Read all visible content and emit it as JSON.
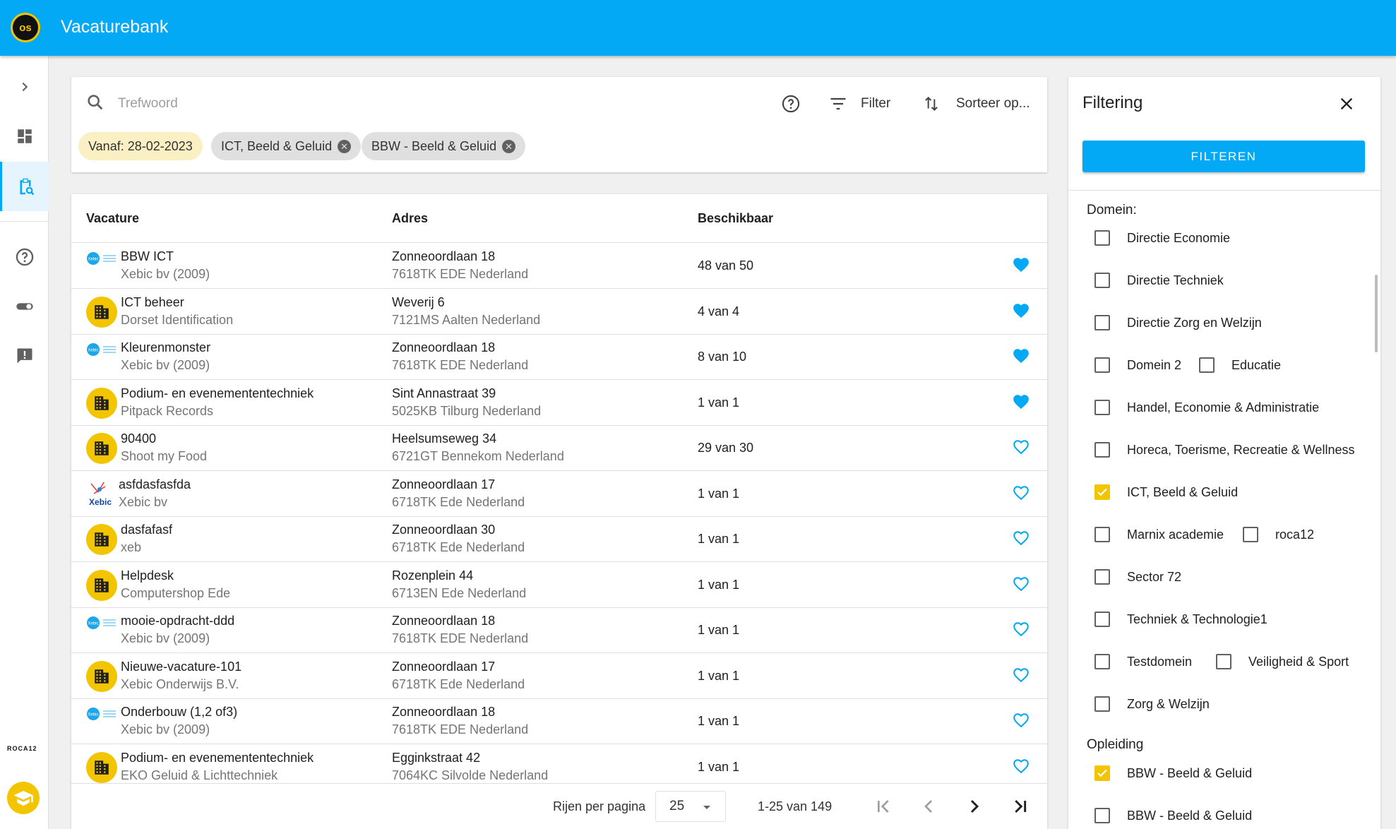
{
  "app": {
    "logo_text": "os",
    "title": "Vacaturebank"
  },
  "sidenav": {
    "items": [
      {
        "name": "expand-icon"
      },
      {
        "name": "dashboard-icon"
      },
      {
        "name": "vacancy-search-icon",
        "active": true
      },
      {
        "name": "help-icon"
      },
      {
        "name": "toggle-icon"
      },
      {
        "name": "feedback-icon"
      }
    ],
    "footer_logo_text": "ROCA12"
  },
  "search": {
    "placeholder": "Trefwoord",
    "filter_label": "Filter",
    "sort_label": "Sorteer op...",
    "chips": [
      {
        "label": "Vanaf: 28-02-2023",
        "removable": false
      },
      {
        "label": "ICT, Beeld & Geluid",
        "removable": true
      },
      {
        "label": "BBW - Beeld & Geluid",
        "removable": true
      }
    ]
  },
  "table": {
    "headers": {
      "vacature": "Vacature",
      "adres": "Adres",
      "beschikbaar": "Beschikbaar"
    },
    "rows": [
      {
        "title": "BBW ICT",
        "company": "Xebic bv (2009)",
        "street": "Zonneoordlaan 18",
        "city": "7618TK EDE Nederland",
        "available": "48 van 50",
        "favorite": true,
        "logo": "xebic"
      },
      {
        "title": "ICT beheer",
        "company": "Dorset Identification",
        "street": "Weverij 6",
        "city": "7121MS Aalten Nederland",
        "available": "4 van 4",
        "favorite": true,
        "logo": "building"
      },
      {
        "title": "Kleurenmonster",
        "company": "Xebic bv (2009)",
        "street": "Zonneoordlaan 18",
        "city": "7618TK EDE Nederland",
        "available": "8 van 10",
        "favorite": true,
        "logo": "xebic"
      },
      {
        "title": "Podium- en evenemententechniek",
        "company": "Pitpack Records",
        "street": "Sint Annastraat 39",
        "city": "5025KB Tilburg Nederland",
        "available": "1 van 1",
        "favorite": true,
        "logo": "building"
      },
      {
        "title": "90400",
        "company": "Shoot my Food",
        "street": "Heelsumseweg 34",
        "city": "6721GT Bennekom Nederland",
        "available": "29 van 30",
        "favorite": false,
        "logo": "building"
      },
      {
        "title": "asfdasfasfda",
        "company": "Xebic bv",
        "street": "Zonneoordlaan 17",
        "city": "6718TK Ede Nederland",
        "available": "1 van 1",
        "favorite": false,
        "logo": "xebic-big"
      },
      {
        "title": "dasfafasf",
        "company": "xeb",
        "street": "Zonneoordlaan 30",
        "city": "6718TK Ede Nederland",
        "available": "1 van 1",
        "favorite": false,
        "logo": "building"
      },
      {
        "title": "Helpdesk",
        "company": "Computershop Ede",
        "street": "Rozenplein 44",
        "city": "6713EN Ede Nederland",
        "available": "1 van 1",
        "favorite": false,
        "logo": "building"
      },
      {
        "title": "mooie-opdracht-ddd",
        "company": "Xebic bv (2009)",
        "street": "Zonneoordlaan 18",
        "city": "7618TK EDE Nederland",
        "available": "1 van 1",
        "favorite": false,
        "logo": "xebic"
      },
      {
        "title": "Nieuwe-vacature-101",
        "company": "Xebic Onderwijs B.V.",
        "street": "Zonneoordlaan 17",
        "city": "6718TK Ede Nederland",
        "available": "1 van 1",
        "favorite": false,
        "logo": "building"
      },
      {
        "title": "Onderbouw (1,2 of3)",
        "company": "Xebic bv (2009)",
        "street": "Zonneoordlaan 18",
        "city": "7618TK EDE Nederland",
        "available": "1 van 1",
        "favorite": false,
        "logo": "xebic"
      },
      {
        "title": "Podium- en evenemententechniek",
        "company": "EKO Geluid & Lichttechniek",
        "street": "Egginkstraat 42",
        "city": "7064KC Silvolde Nederland",
        "available": "1 van 1",
        "favorite": false,
        "logo": "building"
      }
    ],
    "pager": {
      "rows_label": "Rijen per pagina",
      "rows_value": "25",
      "range": "1-25 van 149"
    }
  },
  "filter_panel": {
    "title": "Filtering",
    "button": "FILTEREN",
    "domain_label": "Domein:",
    "domain_options": [
      [
        {
          "label": "Directie Economie",
          "checked": false
        }
      ],
      [
        {
          "label": "Directie Techniek",
          "checked": false
        }
      ],
      [
        {
          "label": "Directie Zorg en Welzijn",
          "checked": false
        }
      ],
      [
        {
          "label": "Domein 2",
          "checked": false
        },
        {
          "label": "Educatie",
          "checked": false
        }
      ],
      [
        {
          "label": "Handel, Economie & Administratie",
          "checked": false
        }
      ],
      [
        {
          "label": "Horeca, Toerisme, Recreatie & Wellness",
          "checked": false
        }
      ],
      [
        {
          "label": "ICT, Beeld & Geluid",
          "checked": true
        }
      ],
      [
        {
          "label": "Marnix academie",
          "checked": false
        },
        {
          "label": "roca12",
          "checked": false
        }
      ],
      [
        {
          "label": "Sector 72",
          "checked": false
        }
      ],
      [
        {
          "label": "Techniek & Technologie1",
          "checked": false
        }
      ],
      [
        {
          "label": "Testdomein",
          "checked": false
        },
        {
          "label": "Veiligheid & Sport",
          "checked": false
        }
      ],
      [
        {
          "label": "Zorg & Welzijn",
          "checked": false
        }
      ]
    ],
    "opleiding_label": "Opleiding",
    "opleiding_options": [
      {
        "label": "BBW - Beeld & Geluid",
        "checked": true
      },
      {
        "label": "BBW - Beeld & Geluid",
        "checked": false
      }
    ]
  },
  "colors": {
    "primary": "#03a9f4",
    "accent": "#f2c500"
  }
}
